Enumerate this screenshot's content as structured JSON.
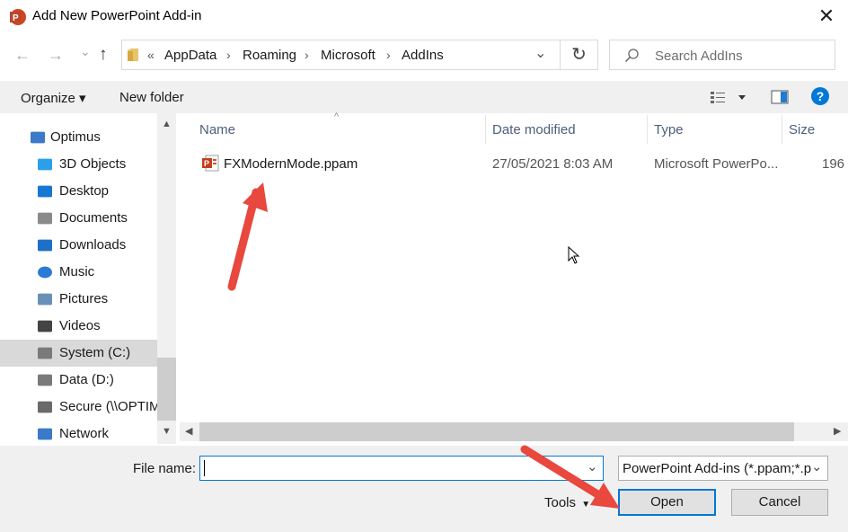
{
  "window": {
    "title": "Add New PowerPoint Add-in",
    "close_glyph": "✕"
  },
  "nav": {
    "back_glyph": "←",
    "forward_glyph": "→",
    "recent_glyph": "⌄",
    "up_glyph": "↑"
  },
  "address": {
    "overflow": "«",
    "crumbs": [
      "AppData",
      "Roaming",
      "Microsoft",
      "AddIns"
    ],
    "separator": "›",
    "dropdown_glyph": "⌄",
    "refresh_glyph": "↻"
  },
  "search": {
    "placeholder": "Search AddIns"
  },
  "toolbar": {
    "organize_label": "Organize ▾",
    "new_folder_label": "New folder",
    "help_glyph": "?"
  },
  "sidebar": {
    "items": [
      {
        "label": "Optimus",
        "icon": "computer-icon"
      },
      {
        "label": "3D Objects",
        "icon": "3d-objects-icon"
      },
      {
        "label": "Desktop",
        "icon": "desktop-icon"
      },
      {
        "label": "Documents",
        "icon": "documents-icon"
      },
      {
        "label": "Downloads",
        "icon": "downloads-icon"
      },
      {
        "label": "Music",
        "icon": "music-icon"
      },
      {
        "label": "Pictures",
        "icon": "pictures-icon"
      },
      {
        "label": "Videos",
        "icon": "videos-icon"
      },
      {
        "label": "System (C:)",
        "icon": "drive-c-icon",
        "selected": true
      },
      {
        "label": "Data (D:)",
        "icon": "drive-d-icon"
      },
      {
        "label": "Secure (\\\\OPTIM",
        "icon": "network-drive-icon"
      },
      {
        "label": "Network",
        "icon": "network-icon"
      }
    ]
  },
  "columns": [
    "Name",
    "Date modified",
    "Type",
    "Size"
  ],
  "files": [
    {
      "name": "FXModernMode.ppam",
      "date": "27/05/2021 8:03 AM",
      "type": "Microsoft PowerPo...",
      "size": "196"
    }
  ],
  "bottom": {
    "filename_label": "File name:",
    "filename_value": "",
    "filter_value": "PowerPoint Add-ins (*.ppam;*.p",
    "tools_label": "Tools",
    "open_label": "Open",
    "cancel_label": "Cancel"
  },
  "colors": {
    "accent": "#0078d7",
    "arrow": "#e8483d",
    "selection": "#d9d9d9",
    "header_text": "#4c607a"
  }
}
